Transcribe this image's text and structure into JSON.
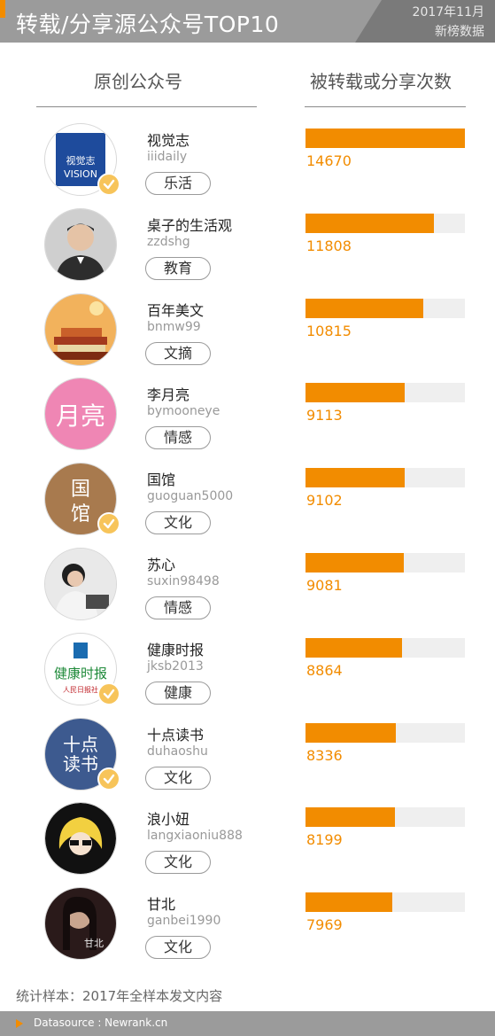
{
  "header": {
    "title": "转载/分享源公众号TOP10",
    "date": "2017年11月",
    "source": "新榜数据"
  },
  "columns": {
    "left": "原创公众号",
    "right": "被转载或分享次数"
  },
  "max_count": 14670,
  "accounts": [
    {
      "name": "视觉志",
      "id": "iiidaily",
      "tag": "乐活",
      "count": 14670,
      "count_label": "14670",
      "verified": true,
      "avatar_text": "视觉志 VISION",
      "avatar_color": "#1e4b9c"
    },
    {
      "name": "桌子的生活观",
      "id": "zzdshg",
      "tag": "教育",
      "count": 11808,
      "count_label": "11808",
      "verified": false,
      "avatar_text": "",
      "avatar_color": "#5b5b5b"
    },
    {
      "name": "百年美文",
      "id": "bnmw99",
      "tag": "文摘",
      "count": 10815,
      "count_label": "10815",
      "verified": false,
      "avatar_text": "",
      "avatar_color": "#c2592a"
    },
    {
      "name": "李月亮",
      "id": "bymooneye",
      "tag": "情感",
      "count": 9113,
      "count_label": "9113",
      "verified": false,
      "avatar_text": "",
      "avatar_color": "#ef86b4"
    },
    {
      "name": "国馆",
      "id": "guoguan5000",
      "tag": "文化",
      "count": 9102,
      "count_label": "9102",
      "verified": true,
      "avatar_text": "国 馆",
      "avatar_color": "#a87a4e"
    },
    {
      "name": "苏心",
      "id": "suxin98498",
      "tag": "情感",
      "count": 9081,
      "count_label": "9081",
      "verified": false,
      "avatar_text": "",
      "avatar_color": "#8b8b8b"
    },
    {
      "name": "健康时报",
      "id": "jksb2013",
      "tag": "健康",
      "count": 8864,
      "count_label": "8864",
      "verified": true,
      "avatar_text": "健康时报",
      "avatar_color": "#ffffff"
    },
    {
      "name": "十点读书",
      "id": "duhaoshu",
      "tag": "文化",
      "count": 8336,
      "count_label": "8336",
      "verified": true,
      "avatar_text": "十点 读书",
      "avatar_color": "#3d5a8f"
    },
    {
      "name": "浪小妞",
      "id": "langxiaoniu888",
      "tag": "文化",
      "count": 8199,
      "count_label": "8199",
      "verified": false,
      "avatar_text": "",
      "avatar_color": "#111111"
    },
    {
      "name": "甘北",
      "id": "ganbei1990",
      "tag": "文化",
      "count": 7969,
      "count_label": "7969",
      "verified": false,
      "avatar_text": "甘北",
      "avatar_color": "#2a1a1a"
    }
  ],
  "note": "统计样本：2017年全样本发文内容",
  "footer": "Datasource : Newrank.cn",
  "colors": {
    "accent": "#f28c00",
    "header_bg": "#9b9b9b",
    "track": "#efefef",
    "badge": "#f7c45a"
  }
}
